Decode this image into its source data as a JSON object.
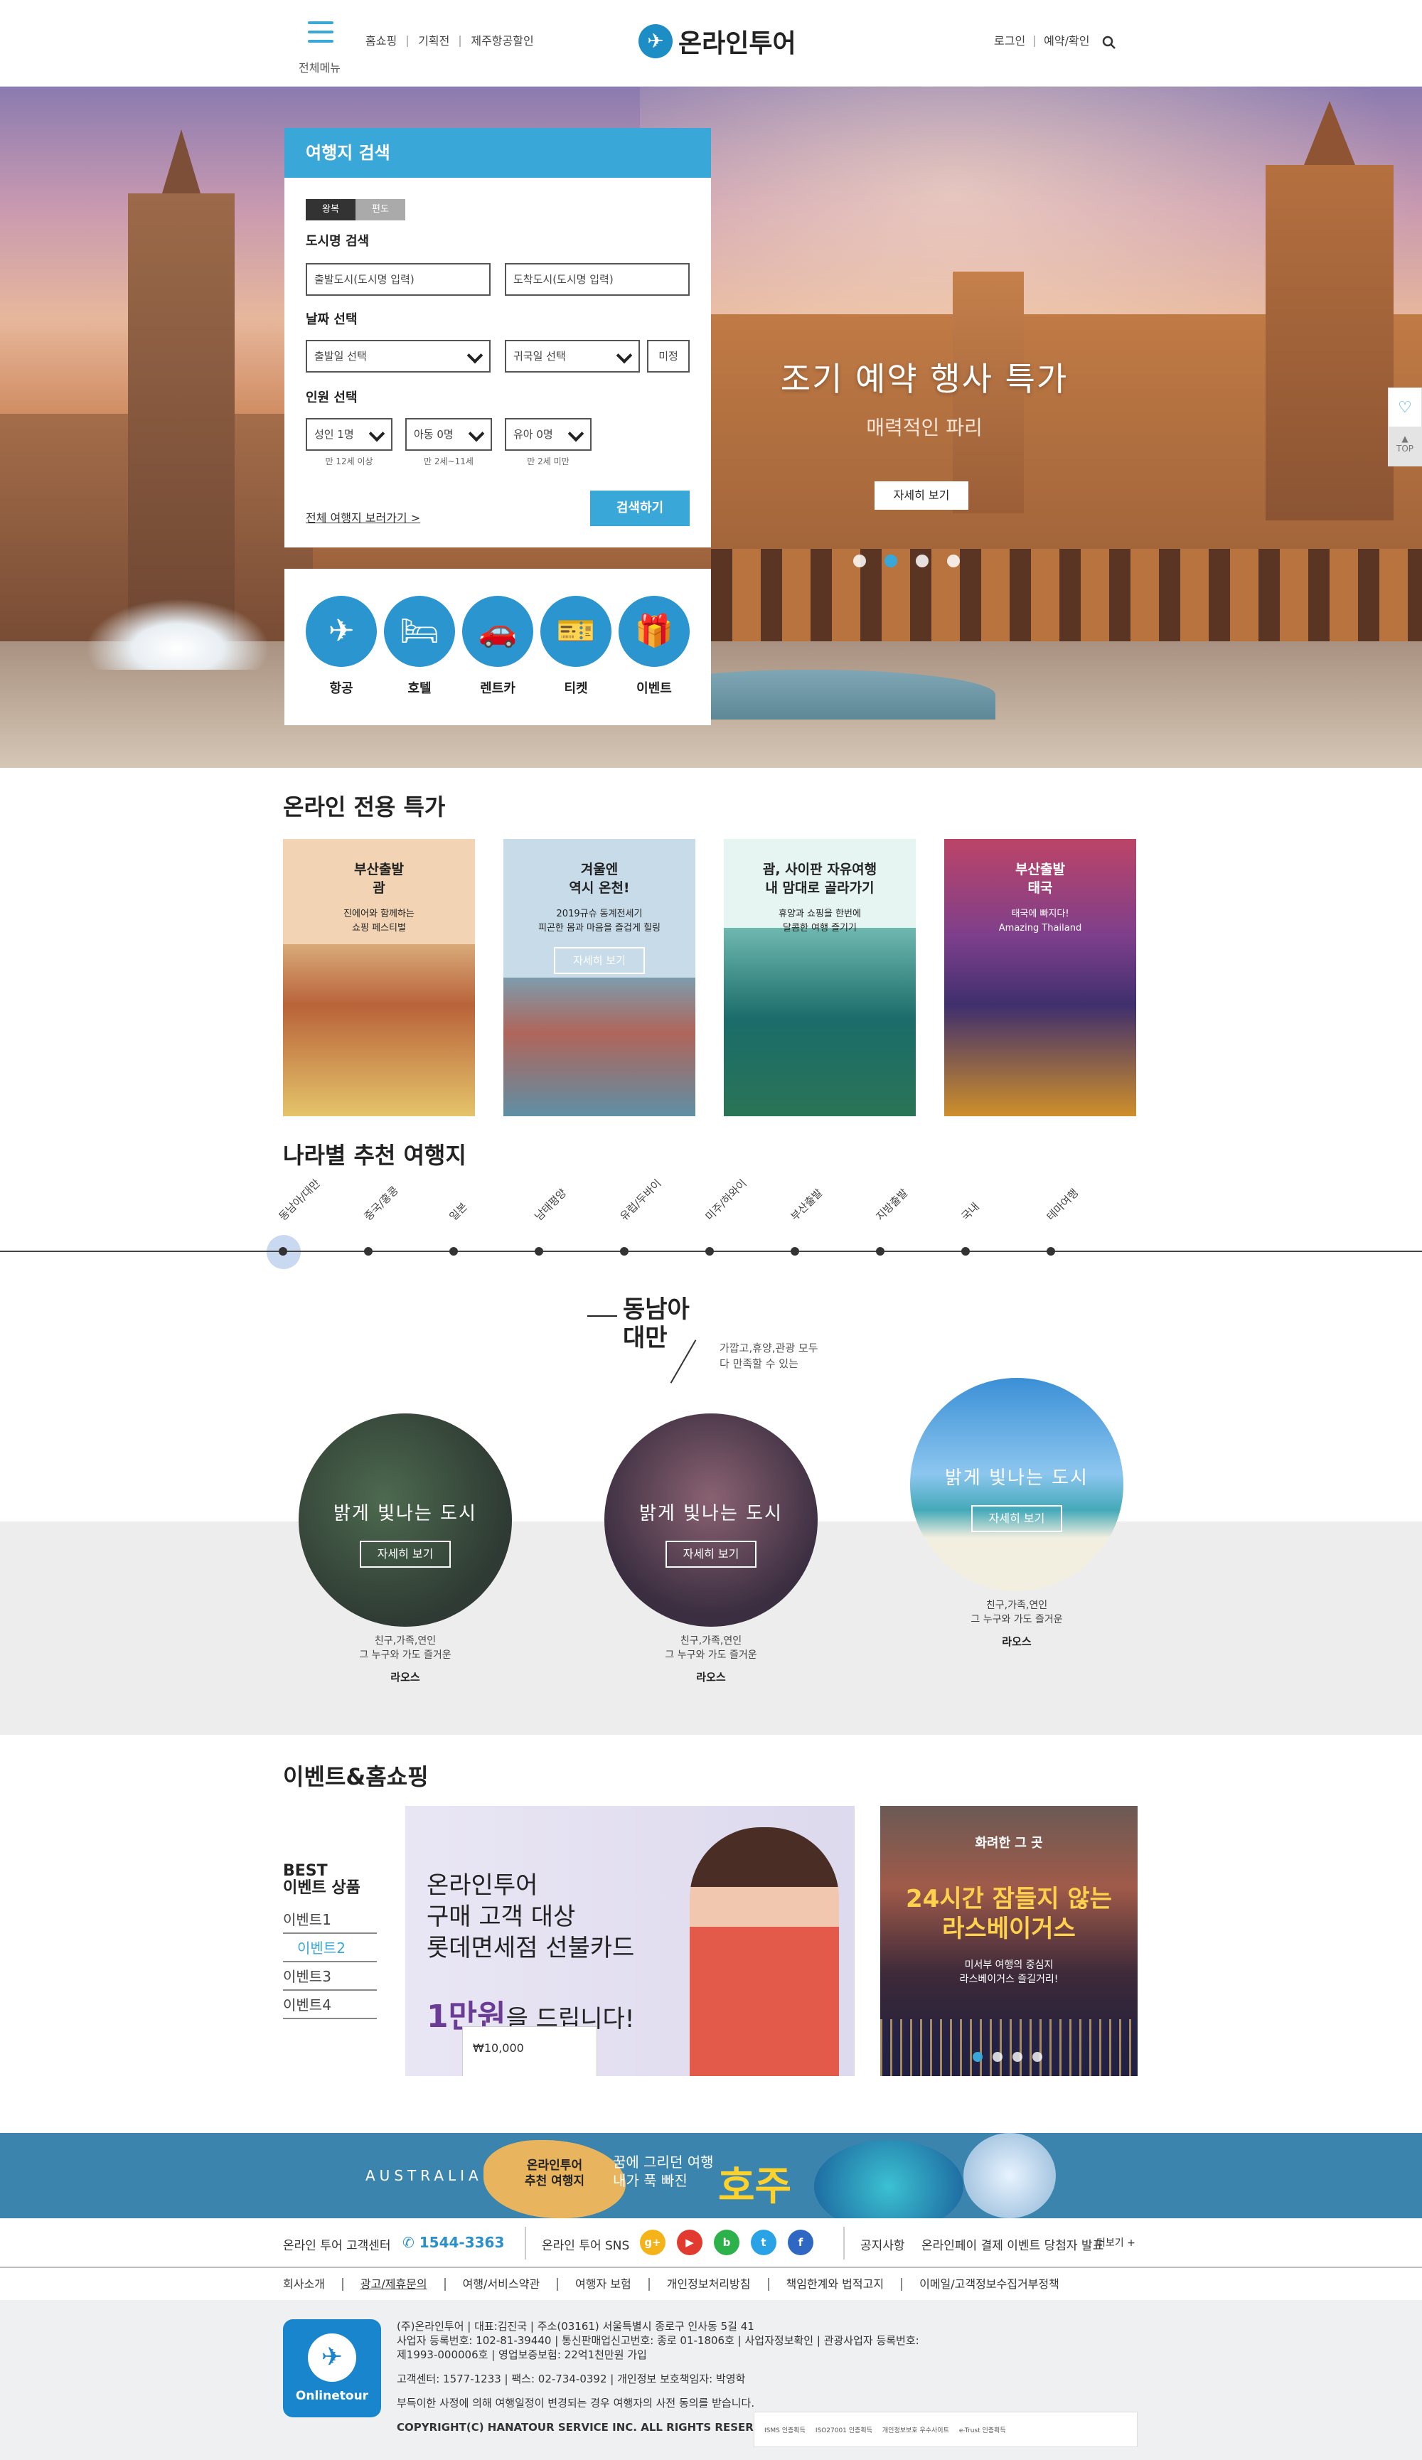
{
  "header": {
    "menu_label": "전체메뉴",
    "nav": [
      "홈쇼핑",
      "기획전",
      "제주항공할인"
    ],
    "logo_text": "온라인투어",
    "util": [
      "로그인",
      "예약/확인"
    ]
  },
  "hero": {
    "title": "조기 예약 행사 특가",
    "subtitle": "매력적인 파리",
    "button": "자세히 보기",
    "slides": 5,
    "active_slide": 2
  },
  "search": {
    "title": "여행지 검색",
    "trip_types": [
      "왕복",
      "편도"
    ],
    "city_label": "도시명 검색",
    "from_placeholder": "출발도시(도시명 입력)",
    "to_placeholder": "도착도시(도시명 입력)",
    "date_label": "날짜 선택",
    "depart_select": "출발일 선택",
    "return_select": "귀국일 선택",
    "undecided": "미정",
    "people_label": "인원 선택",
    "adult": "성인 1명",
    "child": "아동 0명",
    "infant": "유아 0명",
    "adult_note": "만 12세 이상",
    "child_note": "만 2세~11세",
    "infant_note": "만 2세 미만",
    "all_link": "전체 여행지 보러가기 >",
    "submit": "검색하기"
  },
  "categories": [
    {
      "label": "항공",
      "icon": "airplane-icon",
      "glyph": "✈"
    },
    {
      "label": "호텔",
      "icon": "bed-icon",
      "glyph": "🛏"
    },
    {
      "label": "렌트카",
      "icon": "car-icon",
      "glyph": "🚗"
    },
    {
      "label": "티켓",
      "icon": "ticket-icon",
      "glyph": "🎫"
    },
    {
      "label": "이벤트",
      "icon": "gift-icon",
      "glyph": "🎁"
    }
  ],
  "side": {
    "top": "TOP"
  },
  "online_deals": {
    "title": "온라인 전용 특가",
    "items": [
      {
        "title": "부산출발\n괌",
        "sub": "진에어와 함께하는\n쇼핑 페스티벌",
        "button": ""
      },
      {
        "title": "겨울엔\n역시 온천!",
        "sub": "2019규슈 동계전세기\n피곤한 몸과 마음을 즐겁게 힐링",
        "button": "자세히 보기"
      },
      {
        "title": "괌, 사이판 자유여행\n내 맘대로 골라가기",
        "sub": "휴양과 쇼핑을 한번에\n달콤한 여행 즐기기",
        "button": ""
      },
      {
        "title": "부산출발\n태국",
        "sub": "태국에 빠지다!\nAmazing Thailand",
        "button": ""
      }
    ]
  },
  "country": {
    "title": "나라별 추천 여행지",
    "items": [
      "동남아/대만",
      "중국/홍콩",
      "일본",
      "남태평양",
      "유럽/두바이",
      "미주/하와이",
      "부산출발",
      "지방출발",
      "국내",
      "테마여행"
    ],
    "selected": 0
  },
  "region": {
    "title": "동남아\n대만",
    "desc": "가깝고,휴양,관광 모두\n다 만족할 수 있는",
    "cards": [
      {
        "title": "밝게 빛나는 도시",
        "button": "자세히 보기",
        "info": "친구,가족,연인\n그 누구와 가도 즐거운",
        "name": "라오스"
      },
      {
        "title": "밝게 빛나는 도시",
        "button": "자세히 보기",
        "info": "친구,가족,연인\n그 누구와 가도 즐거운",
        "name": "라오스"
      },
      {
        "title": "밝게 빛나는 도시",
        "button": "자세히 보기",
        "info": "친구,가족,연인\n그 누구와 가도 즐거운",
        "name": "라오스"
      }
    ]
  },
  "events": {
    "title": "이벤트&홈쇼핑",
    "best_title": "BEST\n이벤트 상품",
    "best_items": [
      "이벤트1",
      "이벤트2",
      "이벤트3",
      "이벤트4"
    ],
    "best_selected": 1,
    "banner1_text": "온라인투어\n구매 고객 대상\n롯데면세점 선불카드",
    "banner1_amount": "1만원",
    "banner1_suffix": "을 드립니다!",
    "banner1_card": "₩10,000",
    "banner2_top": "화려한 그 곳",
    "banner2_title": "24시간 잠들지 않는\n라스베이거스",
    "banner2_sub": "미서부 여행의 중심지\n라스베이거스 즐길거리!"
  },
  "australia": {
    "label": "AUSTRALIA",
    "badge": "온라인투어\n추천 여행지",
    "tagline": "꿈에 그리던 여행\n내가 푹 빠진",
    "title": "호주"
  },
  "infobar": {
    "cs_label": "온라인 투어 고객센터",
    "phone": "1544-3363",
    "sns_label": "온라인 투어 SNS",
    "sns": [
      {
        "name": "google-plus-icon",
        "glyph": "g+",
        "color": "#f5b31a"
      },
      {
        "name": "youtube-icon",
        "glyph": "▶",
        "color": "#e23a2f"
      },
      {
        "name": "blog-icon",
        "glyph": "b",
        "color": "#2db24b"
      },
      {
        "name": "twitter-icon",
        "glyph": "t",
        "color": "#2aa3e6"
      },
      {
        "name": "facebook-icon",
        "glyph": "f",
        "color": "#2e68c2"
      }
    ],
    "notice_label": "공지사항",
    "notice_text": "온라인페이 결제 이벤트 당첨자 발표",
    "more": "더보기"
  },
  "footer": {
    "links": [
      "회사소개",
      "광고/제휴문의",
      "여행/서비스약관",
      "여행자 보험",
      "개인정보처리방침",
      "책임한계와 법적고지",
      "이메일/고객정보수집거부정책"
    ],
    "logo": "Onlinetour",
    "lines": [
      "(주)온라인투어 | 대표:김진국 | 주소(03161) 서울특별시 종로구 인사동 5길 41",
      "사업자 등록번호: 102-81-39440 | 통신판매업신고번호: 종로 01-1806호 | 사업자정보확인 | 관광사업자 등록번호:",
      "제1993-000006호 | 영업보증보험: 22억1천만원 가입",
      "고객센터: 1577-1233 | 팩스: 02-734-0392 | 개인정보 보호책임자: 박영학",
      "부득이한 사정에 의해 여행일정이 변경되는 경우 여행자의 사전 동의를 받습니다.",
      "COPYRIGHT(C) HANATOUR SERVICE INC. ALL RIGHTS RESERVED"
    ],
    "certs": [
      "ISMS 인증획득",
      "ISO27001 인증획득",
      "개인정보보호 우수사이트",
      "e-Trust 인증획득"
    ]
  }
}
